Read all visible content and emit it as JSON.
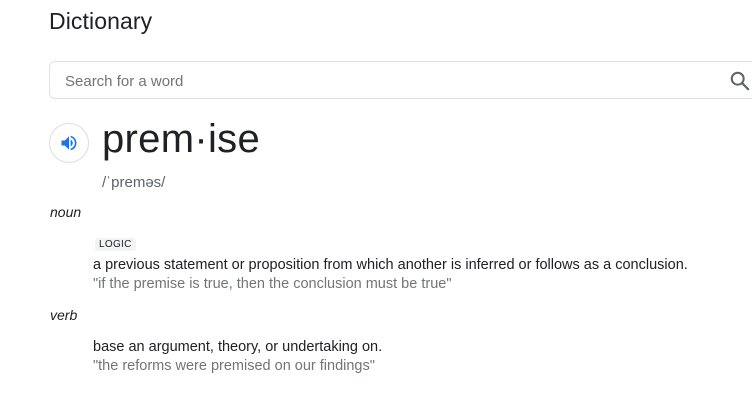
{
  "header": {
    "title": "Dictionary"
  },
  "search": {
    "placeholder": "Search for a word",
    "value": ""
  },
  "entry": {
    "word": "prem·ise",
    "phonetic": "/ˈpreməs/",
    "senses": [
      {
        "part_of_speech": "noun",
        "label": "LOGIC",
        "definition": "a previous statement or proposition from which another is inferred or follows as a conclusion.",
        "example": "\"if the premise is true, then the conclusion must be true\""
      },
      {
        "part_of_speech": "verb",
        "definition": "base an argument, theory, or undertaking on.",
        "example": "\"the reforms were premised on our findings\""
      }
    ]
  },
  "icons": {
    "search": "search-icon",
    "audio": "speaker-icon"
  },
  "colors": {
    "accent": "#1a73e8",
    "search_icon": "#5f6368",
    "text": "#202124",
    "muted": "#70757a"
  }
}
